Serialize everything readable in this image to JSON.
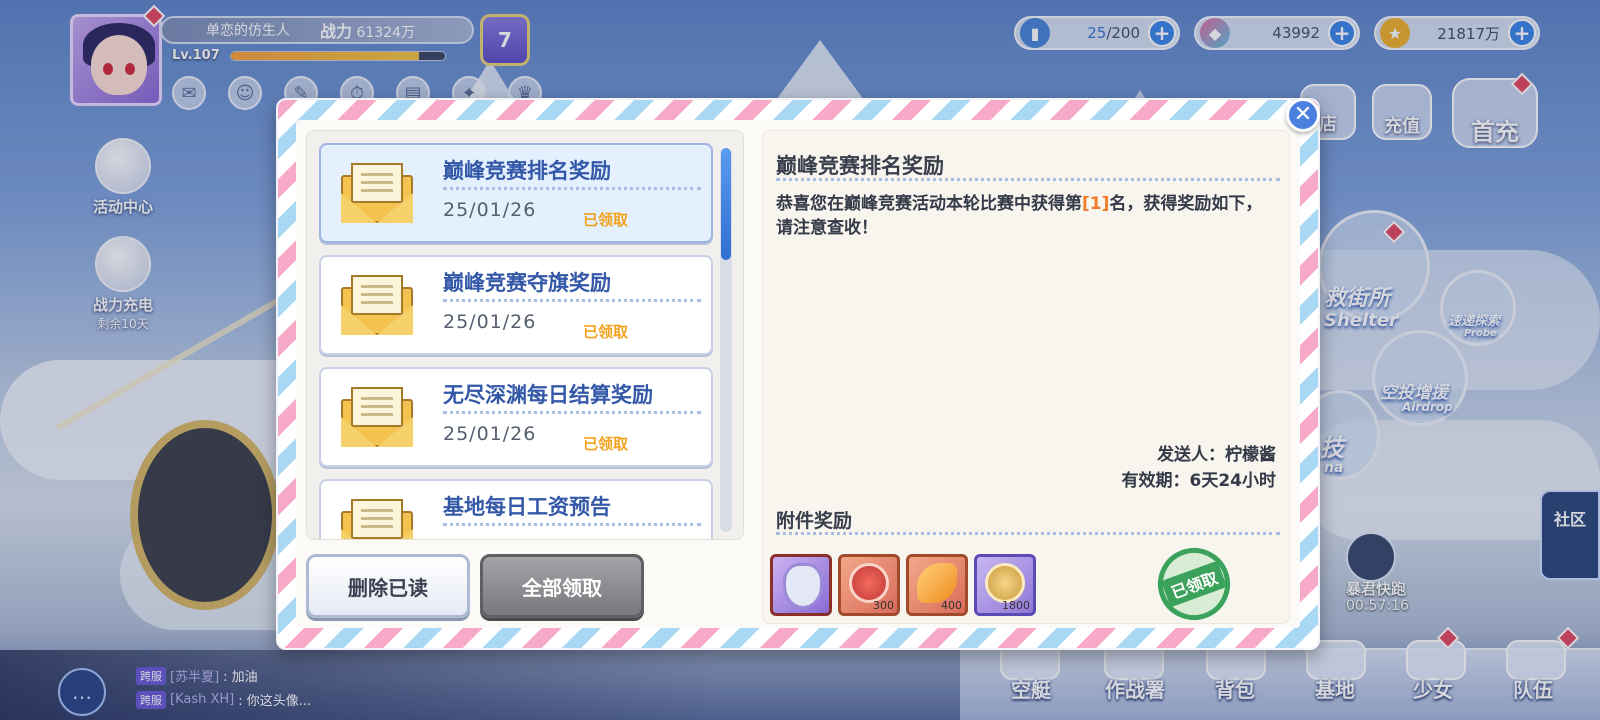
{
  "player": {
    "name": "单恋的仿生人",
    "power_label": "战力",
    "power_value": "61324万",
    "level": "Lv.107",
    "exp_fraction": 0.88,
    "vip_level": "7"
  },
  "resources": [
    {
      "id": "stamina",
      "current": "25",
      "max": "/200"
    },
    {
      "id": "crystal",
      "value": "43992"
    },
    {
      "id": "gold",
      "value": "21817万"
    }
  ],
  "side_menu": [
    {
      "label": "活动中心"
    },
    {
      "label": "战力充电",
      "sub": "剩余10天"
    }
  ],
  "top_right": {
    "shop_partial": "店",
    "recharge": "充值",
    "first_charge": "首充"
  },
  "map": {
    "shelter_cn": "救街所",
    "shelter_en": "Shelter",
    "probe_cn": "速递探索",
    "probe_en": "Probe",
    "airdrop_cn": "空投增援",
    "airdrop_en": "Airdrop",
    "arena_partial_cn": "技",
    "arena_partial_en": "na",
    "community": "社区",
    "event_name": "暴君快跑",
    "event_timer": "00:57:16"
  },
  "bottom_nav": [
    "空艇",
    "作战署",
    "背包",
    "基地",
    "少女",
    "队伍"
  ],
  "chat": [
    {
      "tag": "跨服",
      "name": "[苏半夏]",
      "text": ": 加油"
    },
    {
      "tag": "跨服",
      "name": "[Kash XH]",
      "text": ": 你这头像..."
    }
  ],
  "mail_list": [
    {
      "title": "巅峰竞赛排名奖励",
      "date": "25/01/26",
      "status": "已领取",
      "selected": true
    },
    {
      "title": "巅峰竞赛夺旗奖励",
      "date": "25/01/26",
      "status": "已领取"
    },
    {
      "title": "无尽深渊每日结算奖励",
      "date": "25/01/26",
      "status": "已领取"
    },
    {
      "title": "基地每日工资预告",
      "date": "",
      "status": ""
    }
  ],
  "buttons": {
    "delete_read": "删除已读",
    "claim_all": "全部领取"
  },
  "detail": {
    "title": "巅峰竞赛排名奖励",
    "body_before": "恭喜您在巅峰竞赛活动本轮比赛中获得第",
    "body_rank": "[1]",
    "body_after": "名，获得奖励如下，请注意查收！",
    "sender": "发送人：柠檬酱",
    "validity": "有效期：6天24小时",
    "attachments_title": "附件奖励",
    "claimed_stamp": "已领取"
  },
  "attachments": [
    {
      "name": "avatar-frame",
      "qty": ""
    },
    {
      "name": "red-medal",
      "qty": "300"
    },
    {
      "name": "amber-crystal",
      "qty": "400"
    },
    {
      "name": "gold-medal",
      "qty": "1800"
    }
  ]
}
